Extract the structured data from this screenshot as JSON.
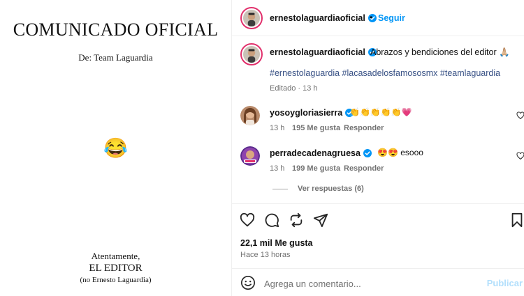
{
  "post_image": {
    "title": "COMUNICADO OFICIAL",
    "from": "De: Team Laguardia",
    "emoji": "😂",
    "sign_line1": "Atentamente,",
    "sign_line2": "EL EDITOR",
    "sign_line3": "(no Ernesto Laguardia)"
  },
  "header": {
    "username": "ernestolaguardiaoficial",
    "separator": "•",
    "follow_label": "Seguir"
  },
  "caption": {
    "username": "ernestolaguardiaoficial",
    "text": "Abrazos y bendiciones del editor 🙏🏼",
    "hashtags": "#ernestolaguardia #lacasadelosfamososmx #teamlaguardia",
    "meta": "Editado · 13 h"
  },
  "comments": [
    {
      "username": "yosoygloriasierra",
      "text": "👏👏👏👏👏💗",
      "time": "13 h",
      "likes": "195 Me gusta",
      "reply_label": "Responder"
    },
    {
      "username": "perradecadenagruesa",
      "text": "😍😍 esooo",
      "time": "13 h",
      "likes": "199 Me gusta",
      "reply_label": "Responder",
      "view_replies": "Ver respuestas (6)"
    }
  ],
  "actions": {
    "likes_count": "22,1 mil Me gusta",
    "time_ago": "Hace 13 horas"
  },
  "add_comment": {
    "placeholder": "Agrega un comentario...",
    "publish_label": "Publicar"
  },
  "colors": {
    "link_blue": "#0095f6",
    "hashtag": "#385185",
    "muted": "#737373",
    "heart_pink": "#e1306c"
  }
}
